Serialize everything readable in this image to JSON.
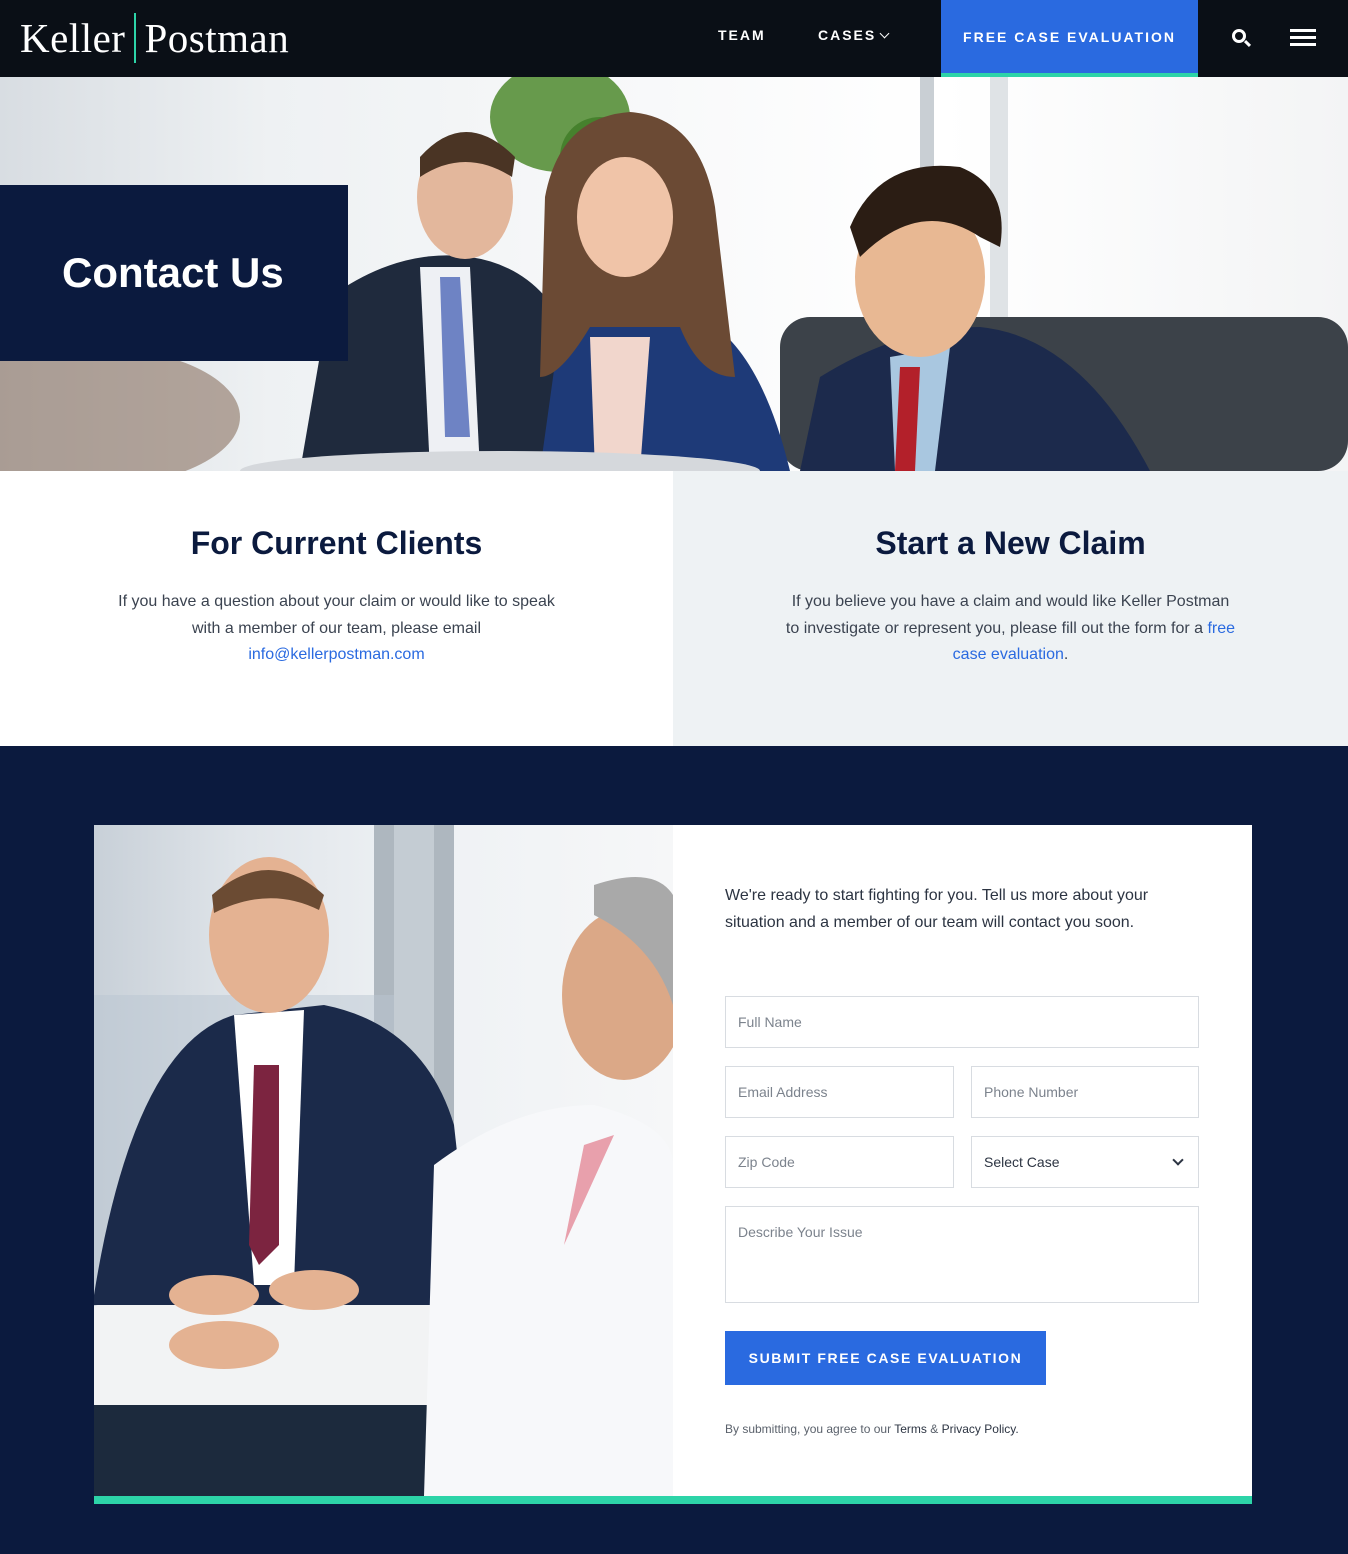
{
  "header": {
    "logo_left": "Keller",
    "logo_right": "Postman",
    "nav": [
      {
        "label": "TEAM"
      },
      {
        "label": "CASES"
      }
    ],
    "cta_label": "FREE CASE EVALUATION"
  },
  "hero": {
    "title": "Contact Us"
  },
  "current_clients": {
    "heading": "For Current Clients",
    "text": "If you have a question about your claim or would like to speak with a member of our team, please email",
    "email": "info@kellerpostman.com"
  },
  "new_claim": {
    "heading": "Start a New Claim",
    "text": "If you believe you have a claim and would like Keller Postman to investigate or represent you, please fill out the form for a",
    "link": "free case evaluation",
    "after_link": "."
  },
  "form": {
    "intro": "We're ready to start fighting for you. Tell us more about your situation and a member of our team will contact you soon.",
    "full_name_placeholder": "Full Name",
    "email_placeholder": "Email Address",
    "phone_placeholder": "Phone Number",
    "zip_placeholder": "Zip Code",
    "case_select": "Select Case",
    "issue_placeholder": "Describe Your Issue",
    "submit_label": "SUBMIT FREE CASE EVALUATION",
    "legal_prefix": "By submitting, you agree to our",
    "terms_link": "Terms",
    "legal_amp": "&",
    "privacy_link": "Privacy Policy."
  },
  "colors": {
    "navy": "#0b1a3e",
    "header_black": "#0a0f16",
    "brand_blue": "#2a6ae0",
    "accent_teal": "#2dd4a8",
    "light_panel": "#eef2f4"
  }
}
